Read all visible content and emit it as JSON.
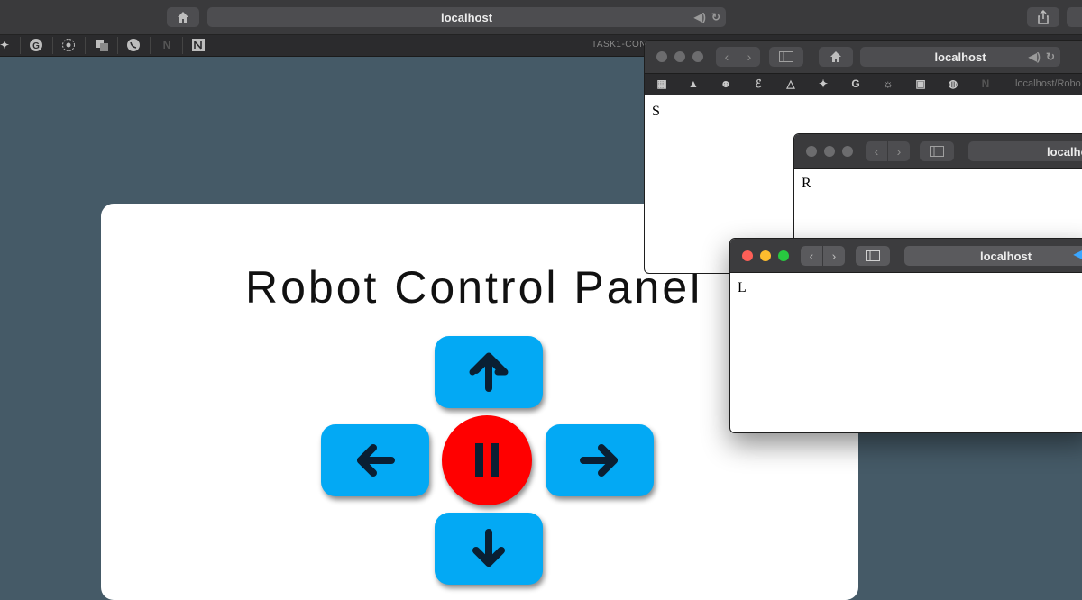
{
  "browser": {
    "url": "localhost",
    "tab_title": "TASK1-CON"
  },
  "page": {
    "title": "Robot Control Panel"
  },
  "controls": {
    "forward": "forward",
    "left": "left",
    "stop": "stop",
    "right": "right",
    "backward": "backward",
    "colors": {
      "direction": "#03a9f4",
      "stop": "#ff0000",
      "icon": "#0a1f33"
    }
  },
  "windows": [
    {
      "url": "localhost",
      "favorites_trailing_text": "localhost/Robo",
      "content": "S"
    },
    {
      "url": "localhost",
      "content": "R"
    },
    {
      "url": "localhost",
      "content": "L"
    }
  ]
}
